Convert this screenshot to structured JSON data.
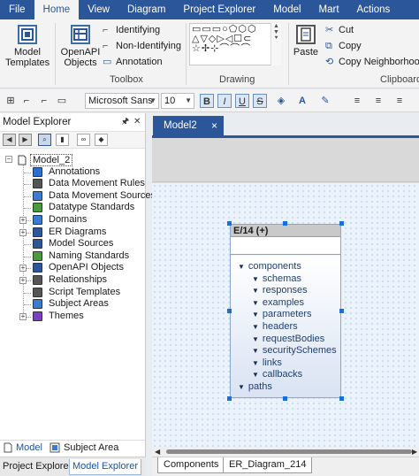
{
  "menu": {
    "items": [
      "File",
      "Home",
      "View",
      "Diagram",
      "Project Explorer",
      "Model",
      "Mart",
      "Actions"
    ],
    "active": "Home"
  },
  "ribbon": {
    "model_templates": "Model Templates",
    "openapi_objects": "OpenAPI Objects",
    "identifying": "Identifying",
    "non_identifying": "Non-Identifying",
    "annotation": "Annotation",
    "toolbox_label": "Toolbox",
    "drawing_label": "Drawing",
    "paste": "Paste",
    "cut": "Cut",
    "copy": "Copy",
    "copy_neighborhood": "Copy Neighborhoo",
    "clipboard_label": "Clipboard"
  },
  "format_bar": {
    "font_name": "Microsoft Sans",
    "font_size": "10",
    "bold": "B",
    "italic": "I",
    "underline": "U",
    "strike": "S"
  },
  "model_explorer": {
    "title": "Model Explorer",
    "pin_icon": "pin-icon",
    "close_icon": "close-icon",
    "root": "Model_2",
    "tree": [
      {
        "label": "Annotations",
        "expandable": false,
        "icon": "annotation-icon",
        "color": "#2b6fd0"
      },
      {
        "label": "Data Movement Rules",
        "expandable": false,
        "icon": "rules-icon",
        "color": "#555555"
      },
      {
        "label": "Data Movement Sources",
        "expandable": false,
        "icon": "sources-icon",
        "color": "#3a7bd5"
      },
      {
        "label": "Datatype Standards",
        "expandable": false,
        "icon": "standards-icon",
        "color": "#4c9a3e"
      },
      {
        "label": "Domains",
        "expandable": true,
        "icon": "domains-icon",
        "color": "#3a7bd5"
      },
      {
        "label": "ER Diagrams",
        "expandable": true,
        "icon": "diagram-icon",
        "color": "#2b579a"
      },
      {
        "label": "Model Sources",
        "expandable": false,
        "icon": "model-sources-icon",
        "color": "#2b579a"
      },
      {
        "label": "Naming Standards",
        "expandable": false,
        "icon": "naming-icon",
        "color": "#4c9a3e"
      },
      {
        "label": "OpenAPI Objects",
        "expandable": true,
        "icon": "openapi-icon",
        "color": "#2b579a"
      },
      {
        "label": "Relationships",
        "expandable": true,
        "icon": "relationship-icon",
        "color": "#555555"
      },
      {
        "label": "Script Templates",
        "expandable": false,
        "icon": "script-icon",
        "color": "#555555"
      },
      {
        "label": "Subject Areas",
        "expandable": false,
        "icon": "subject-area-icon",
        "color": "#3a7bd5"
      },
      {
        "label": "Themes",
        "expandable": true,
        "icon": "theme-icon",
        "color": "#7a3fc2"
      }
    ],
    "bottom_tabs": {
      "model": "Model",
      "subject_area": "Subject Area"
    }
  },
  "panel_tabs": {
    "project_explorer": "Project Explorer",
    "model_explorer": "Model Explorer"
  },
  "document": {
    "tab_title": "Model2",
    "close_glyph": "×"
  },
  "entity": {
    "title": "E/14 (+)",
    "rows": [
      {
        "label": "components",
        "indent": 0
      },
      {
        "label": "schemas",
        "indent": 1
      },
      {
        "label": "responses",
        "indent": 1
      },
      {
        "label": "examples",
        "indent": 1
      },
      {
        "label": "parameters",
        "indent": 1
      },
      {
        "label": "headers",
        "indent": 1
      },
      {
        "label": "requestBodies",
        "indent": 1
      },
      {
        "label": "securitySchemes",
        "indent": 1
      },
      {
        "label": "links",
        "indent": 1
      },
      {
        "label": "callbacks",
        "indent": 1
      },
      {
        "label": "paths",
        "indent": 0
      }
    ]
  },
  "sheet_tabs": [
    "Components",
    "ER_Diagram_214"
  ],
  "colors": {
    "accent": "#2b579a",
    "selection_handle": "#1a6fd8"
  }
}
